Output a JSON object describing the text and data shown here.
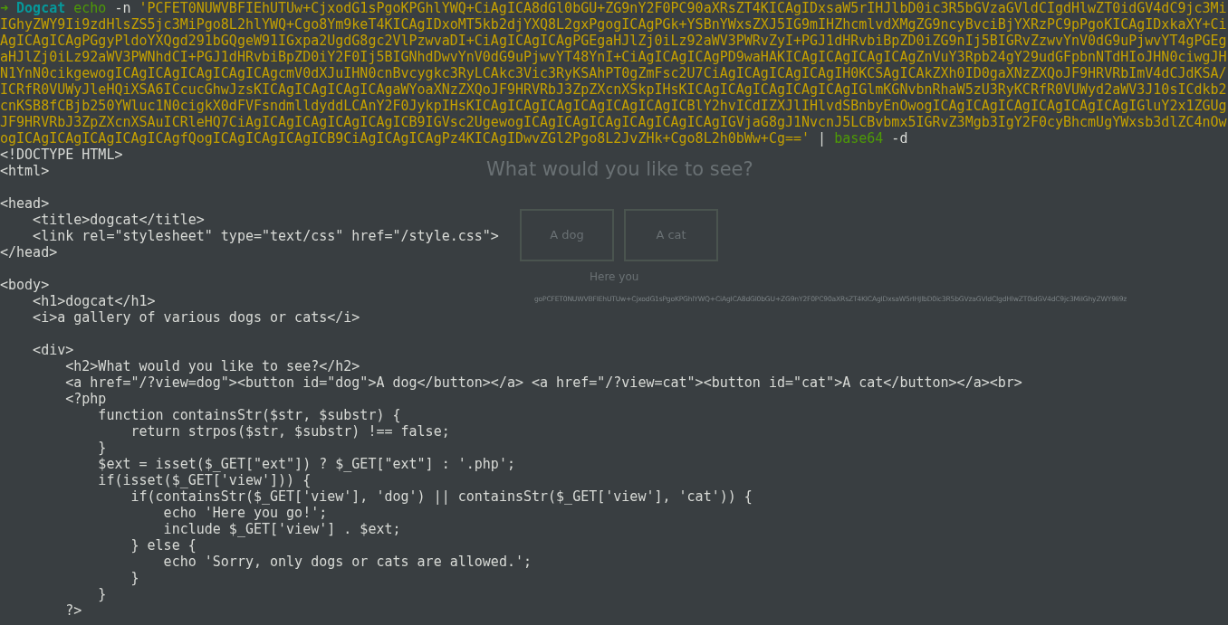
{
  "terminal": {
    "command": {
      "prompt_symbol": "➜",
      "directory": "Dogcat",
      "program": "echo",
      "flag": "-n",
      "argument": "'PCFET0NUWVBFIEhUTUw+CjxodG1sPgoKPGhlYWQ+CiAgICA8dGl0bGU+ZG9nY2F0PC90aXRsZT4KICAgIDxsaW5rIHJlbD0ic3R5bGVzaGVldCIgdHlwZT0idGV4dC9jc3MiIGhyZWY9Ii9zdHlsZS5jc3MiPgo8L2hlYWQ+Cgo8Ym9keT4KICAgIDxoMT5kb2djYXQ8L2gxPgogICAgPGk+YSBnYWxsZXJ5IG9mIHZhcmlvdXMgZG9ncyBvciBjYXRzPC9pPgoKICAgIDxkaXY+CiAgICAgICAgPGgyPldoYXQgd291bGQgeW91IGxpa2UgdG8gc2VlPzwvaDI+CiAgICAgICAgPGEgaHJlZj0iLz92aWV3PWRvZyI+PGJ1dHRvbiBpZD0iZG9nIj5BIGRvZzwvYnV0dG9uPjwvYT4gPGEgaHJlZj0iLz92aWV3PWNhdCI+PGJ1dHRvbiBpZD0iY2F0Ij5BIGNhdDwvYnV0dG9uPjwvYT48YnI+CiAgICAgICAgPD9waHAKICAgICAgICAgICAgZnVuY3Rpb24gY29udGFpbnNTdHIoJHN0ciwgJHN1YnN0cikgewogICAgICAgICAgICAgICAgcmV0dXJuIHN0cnBvcygkc3RyLCAkc3Vic3RyKSAhPT0gZmFsc2U7CiAgICAgICAgICAgIH0KCSAgICAkZXh0ID0gaXNzZXQoJF9HRVRbImV4dCJdKSA/ICRfR0VUWyJleHQiXSA6ICcucGhwJzsKICAgICAgICAgICAgaWYoaXNzZXQoJF9HRVRbJ3ZpZXcnXSkpIHsKICAgICAgICAgICAgICAgIGlmKGNvbnRhaW5zU3RyKCRfR0VUWyd2aWV3J10sICdkb2cnKSB8fCBjb250YWluc1N0cigkX0dFVFsndmlldyddLCAnY2F0JykpIHsKICAgICAgICAgICAgICAgICAgICBlY2hvICdIZXJlIHlvdSBnbyEnOwogICAgICAgICAgICAgICAgICAgIGluY2x1ZGUgJF9HRVRbJ3ZpZXcnXSAuICRleHQ7CiAgICAgICAgICAgICAgICB9IGVsc2UgewogICAgICAgICAgICAgICAgICAgIGVjaG8gJ1NvcnJ5LCBvbmx5IGRvZ3Mgb3IgY2F0cyBhcmUgYWxsb3dlZC4nOwogICAgICAgICAgICAgICAgfQogICAgICAgICAgICB9CiAgICAgICAgPz4KICAgIDwvZGl2Pgo8L2JvZHk+Cgo8L2h0bWw+Cg=='",
      "pipe": "|",
      "pipe_program": "base64",
      "pipe_flag": "-d"
    },
    "output": "<!DOCTYPE HTML>\n<html>\n\n<head>\n    <title>dogcat</title>\n    <link rel=\"stylesheet\" type=\"text/css\" href=\"/style.css\">\n</head>\n\n<body>\n    <h1>dogcat</h1>\n    <i>a gallery of various dogs or cats</i>\n\n    <div>\n        <h2>What would you like to see?</h2>\n        <a href=\"/?view=dog\"><button id=\"dog\">A dog</button></a> <a href=\"/?view=cat\"><button id=\"cat\">A cat</button></a><br>\n        <?php\n            function containsStr($str, $substr) {\n                return strpos($str, $substr) !== false;\n            }\n            $ext = isset($_GET[\"ext\"]) ? $_GET[\"ext\"] : '.php';\n            if(isset($_GET['view'])) {\n                if(containsStr($_GET['view'], 'dog') || containsStr($_GET['view'], 'cat')) {\n                    echo 'Here you go!';\n                    include $_GET['view'] . $ext;\n                } else {\n                    echo 'Sorry, only dogs or cats are allowed.';\n                }\n            }\n        ?>"
  },
  "background_page": {
    "heading": "What would you like to see?",
    "buttons": [
      "A dog",
      "A cat"
    ],
    "message": "Here you",
    "output_text": "goPCFET0NUWVBFIEhUTUw+CjxodG1sPgoKPGhlYWQ+CiAgICA8dGl0bGU+ZG9nY2F0PC90aXRsZT4KICAgIDxsaW5rIHJlbD0ic3R5bGVzaGVldCIgdHlwZT0idGV4dC9jc3MiIGhyZWY9Ii9z"
  }
}
